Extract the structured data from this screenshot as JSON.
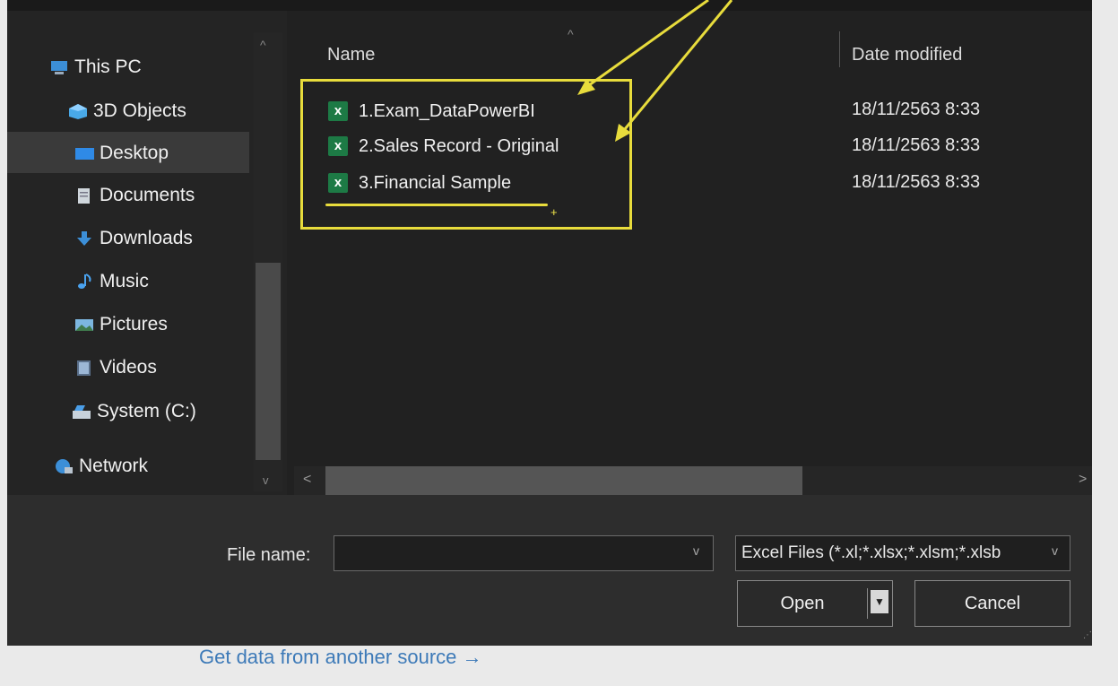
{
  "nav": {
    "items": [
      {
        "label": "This PC",
        "icon": "pc-icon"
      },
      {
        "label": "3D Objects",
        "icon": "cube-icon"
      },
      {
        "label": "Desktop",
        "icon": "desktop-icon"
      },
      {
        "label": "Documents",
        "icon": "document-icon"
      },
      {
        "label": "Downloads",
        "icon": "download-icon"
      },
      {
        "label": "Music",
        "icon": "music-icon"
      },
      {
        "label": "Pictures",
        "icon": "picture-icon"
      },
      {
        "label": "Videos",
        "icon": "video-icon"
      },
      {
        "label": "System (C:)",
        "icon": "drive-icon"
      },
      {
        "label": "Network",
        "icon": "network-icon"
      }
    ],
    "selected": "Desktop"
  },
  "list": {
    "headers": {
      "name": "Name",
      "date": "Date modified"
    },
    "files": [
      {
        "name": "1.Exam_DataPowerBI",
        "date": "18/11/2563 8:33",
        "icon": "excel-file-icon"
      },
      {
        "name": "2.Sales Record - Original",
        "date": "18/11/2563 8:33",
        "icon": "excel-file-icon"
      },
      {
        "name": "3.Financial Sample",
        "date": "18/11/2563 8:33",
        "icon": "excel-file-icon"
      }
    ]
  },
  "bottom": {
    "filename_label": "File name:",
    "filename_value": "",
    "filter": "Excel Files (*.xl;*.xlsx;*.xlsm;*.xlsb",
    "open_label": "Open",
    "cancel_label": "Cancel"
  },
  "footer_link": "Get data from another source →",
  "annotation_color": "#e8dc3c"
}
